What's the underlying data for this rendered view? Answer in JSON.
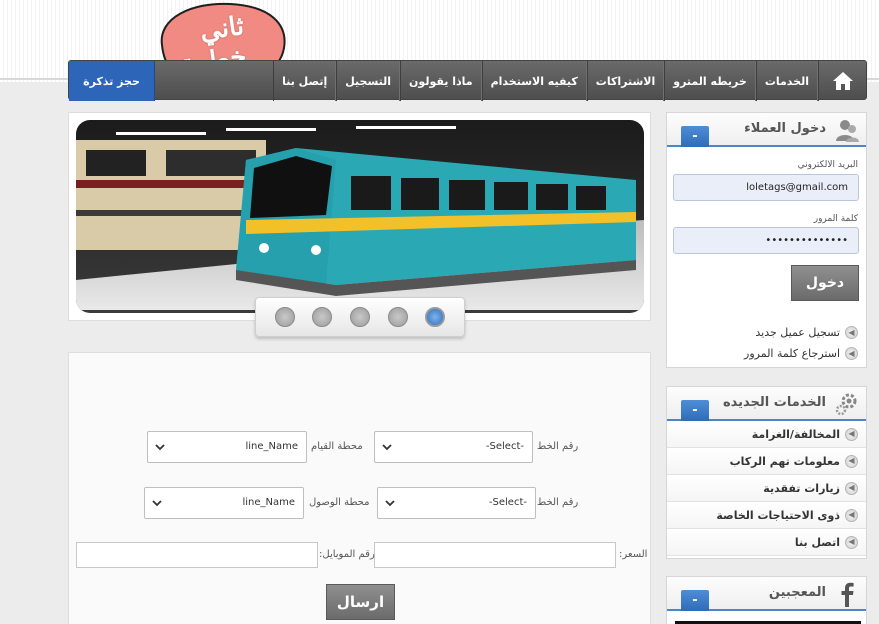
{
  "logo": {
    "line1": "ثاني",
    "line2": "خطوة"
  },
  "nav": {
    "book_label": "حجز تذكرة",
    "items": [
      "الخدمات",
      "خريطه المترو",
      "الاشتراكات",
      "كيفيه الاستخدام",
      "ماذا يقولون",
      "التسجيل",
      "إتصل بنا"
    ]
  },
  "slider": {
    "dot_count": 5,
    "active_dot": 5
  },
  "booking": {
    "row1": {
      "line_label": "رقم الخط",
      "line_value": "-Select-",
      "station_label": "محطة القيام",
      "station_value": "line_Name"
    },
    "row2": {
      "line_label": "رقم الخط",
      "line_value": "-Select-",
      "station_label": "محطة الوصول",
      "station_value": "line_Name"
    },
    "price_label": "السعر:",
    "mobile_label": "رقم الموبايل:",
    "submit_label": "ارسال"
  },
  "login": {
    "title": "دخول العملاء",
    "toggle": "-",
    "email_label": "البريد الالكتروني",
    "email_value": "loletags@gmail.com",
    "password_label": "كلمة المرور",
    "password_value": "••••••••••••••",
    "submit_label": "دخول",
    "links": [
      "تسجيل عميل جديد",
      "استرجاع كلمة المرور"
    ]
  },
  "services": {
    "title": "الخدمات الجديده",
    "toggle": "-",
    "items": [
      "المخالفة/الغرامة",
      "معلومات تهم الركاب",
      "زيارات تفقدية",
      "ذوى الاحتياجات الخاصة",
      "اتصل بنا"
    ]
  },
  "fans": {
    "title": "المعجبين",
    "toggle": "-"
  },
  "colors": {
    "accent": "#2d66b8",
    "nav": "#555555",
    "logo_bubble": "#f08a82"
  },
  "icons": {
    "home": "home-icon",
    "user": "user-icon",
    "gear": "gear-icon",
    "facebook": "facebook-icon",
    "arrow": "arrow-left-icon",
    "chevron": "chevron-down-icon"
  }
}
